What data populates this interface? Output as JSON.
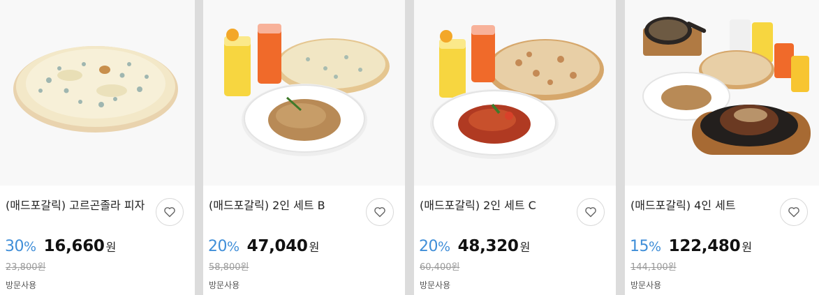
{
  "products": [
    {
      "title": "(매드포갈릭) 고르곤졸라 피자",
      "discount": "30",
      "pct": "%",
      "price": "16,660",
      "won": "원",
      "original_price": "23,800원",
      "tag": "방문사용",
      "image": "gorgonzola-pizza"
    },
    {
      "title": "(매드포갈릭) 2인 세트 B",
      "discount": "20",
      "pct": "%",
      "price": "47,040",
      "won": "원",
      "original_price": "58,800원",
      "tag": "방문사용",
      "image": "set-b-pizza-pasta-drinks"
    },
    {
      "title": "(매드포갈릭) 2인 세트 C",
      "discount": "20",
      "pct": "%",
      "price": "48,320",
      "won": "원",
      "original_price": "60,400원",
      "tag": "방문사용",
      "image": "set-c-pizza-pasta-drinks"
    },
    {
      "title": "(매드포갈릭) 4인 세트",
      "discount": "15",
      "pct": "%",
      "price": "122,480",
      "won": "원",
      "original_price": "144,100원",
      "tag": "방문사용",
      "image": "set-4-steak-pizza-pasta-drinks"
    }
  ],
  "icons": {
    "wishlist": "heart-outline-icon"
  },
  "colors": {
    "discount": "#3f8ed8",
    "page_background": "#dcdcdc",
    "card": "#ffffff"
  }
}
